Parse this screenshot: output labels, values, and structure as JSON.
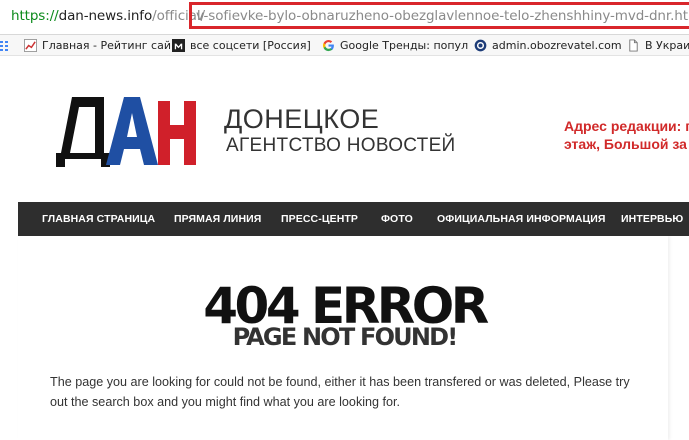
{
  "browser": {
    "url": {
      "scheme": "https://",
      "host": "dan-news.info",
      "path_visible": "/official/",
      "slug_highlighted": "v-sofievke-bylo-obnaruzheno-obezglavlennoe-telo-zhenshhiny-mvd-dnr.html"
    },
    "highlight_color": "#d9262b",
    "bookmarks": [
      {
        "label": "Главная - Рейтинг сай",
        "icon": "chart-favicon-icon"
      },
      {
        "label": "все соцсети [Россия]",
        "icon": "m-favicon-icon"
      },
      {
        "label": "Google Тренды: попул",
        "icon": "google-g-icon"
      },
      {
        "label": "admin.obozrevatel.com",
        "icon": "obozrevatel-favicon-icon"
      },
      {
        "label": "В Украин",
        "icon": "page-icon"
      }
    ]
  },
  "site": {
    "logo_letters": "ДАН",
    "agency_name_line1": "ДОНЕЦКОЕ",
    "agency_name_line2": "АГЕНТСТВО НОВОСТЕЙ",
    "address_line1": "Адрес редакции: г",
    "address_line2": "этаж, Большой за",
    "nav": [
      "ГЛАВНАЯ СТРАНИЦА",
      "ПРЯМАЯ ЛИНИЯ",
      "ПРЕСС-ЦЕНТР",
      "ФОТО",
      "ОФИЦИАЛЬНАЯ ИНФОРМАЦИЯ",
      "ИНТЕРВЬЮ"
    ],
    "colors": {
      "nav_bg": "#2e2e2e",
      "address": "#d12a2a",
      "logo_black": "#111111",
      "logo_blue": "#1f4fa3",
      "logo_red": "#d0202a"
    }
  },
  "error": {
    "code": "404 ERROR",
    "title": "PAGE NOT FOUND!",
    "message": "The page you are looking for could not be found, either it has been transfered or was deleted, Please try out the search box and you might find what you are looking for."
  }
}
